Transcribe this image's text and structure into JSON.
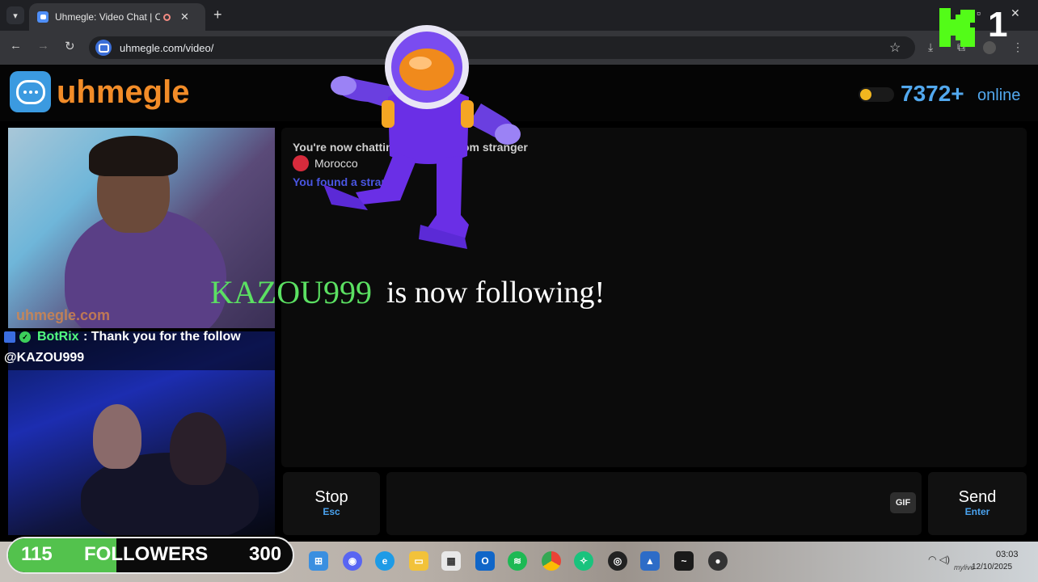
{
  "browser": {
    "tab_title": "Uhmegle: Video Chat | Omegle",
    "url": "uhmegle.com/video/",
    "new_tab_icon": "plus-icon",
    "window_controls": [
      "minimize-icon",
      "restore-icon",
      "close-icon"
    ]
  },
  "site": {
    "brand": "uhmegle",
    "online_count": "7372+",
    "online_label": "online",
    "accent_color": "#f28c28",
    "online_color": "#52a8ee"
  },
  "overlay": {
    "follow_username": "KAZOU999",
    "follow_text": "is now following!",
    "kick_count": "1"
  },
  "videos": {
    "watermark": "uhmegle.com"
  },
  "stream_chat": {
    "bot_name": "BotRix",
    "message_part1": ": Thank you for the follow",
    "message_part2": "@KAZOU999"
  },
  "chat": {
    "system_line": "You're now chatting with a random stranger",
    "country": "Morocco",
    "you_line": "You found a stranger"
  },
  "controls": {
    "stop_label": "Stop",
    "stop_key": "Esc",
    "message_placeholder": "",
    "gif_label": "GIF",
    "send_label": "Send",
    "send_key": "Enter"
  },
  "followers_goal": {
    "current": "115",
    "label": "FOLLOWERS",
    "target": "300",
    "progress_fraction": 0.38
  },
  "taskbar": {
    "apps": [
      "windows-icon",
      "discord-icon",
      "edge-icon",
      "files-icon",
      "store-icon",
      "outlook-icon",
      "spotify-icon",
      "chrome-icon",
      "chatgpt-icon",
      "webcam-icon",
      "photos-icon",
      "terminal-icon",
      "obs-icon"
    ],
    "time": "03:03",
    "date": "12/10/2025",
    "signature": "mylive"
  }
}
